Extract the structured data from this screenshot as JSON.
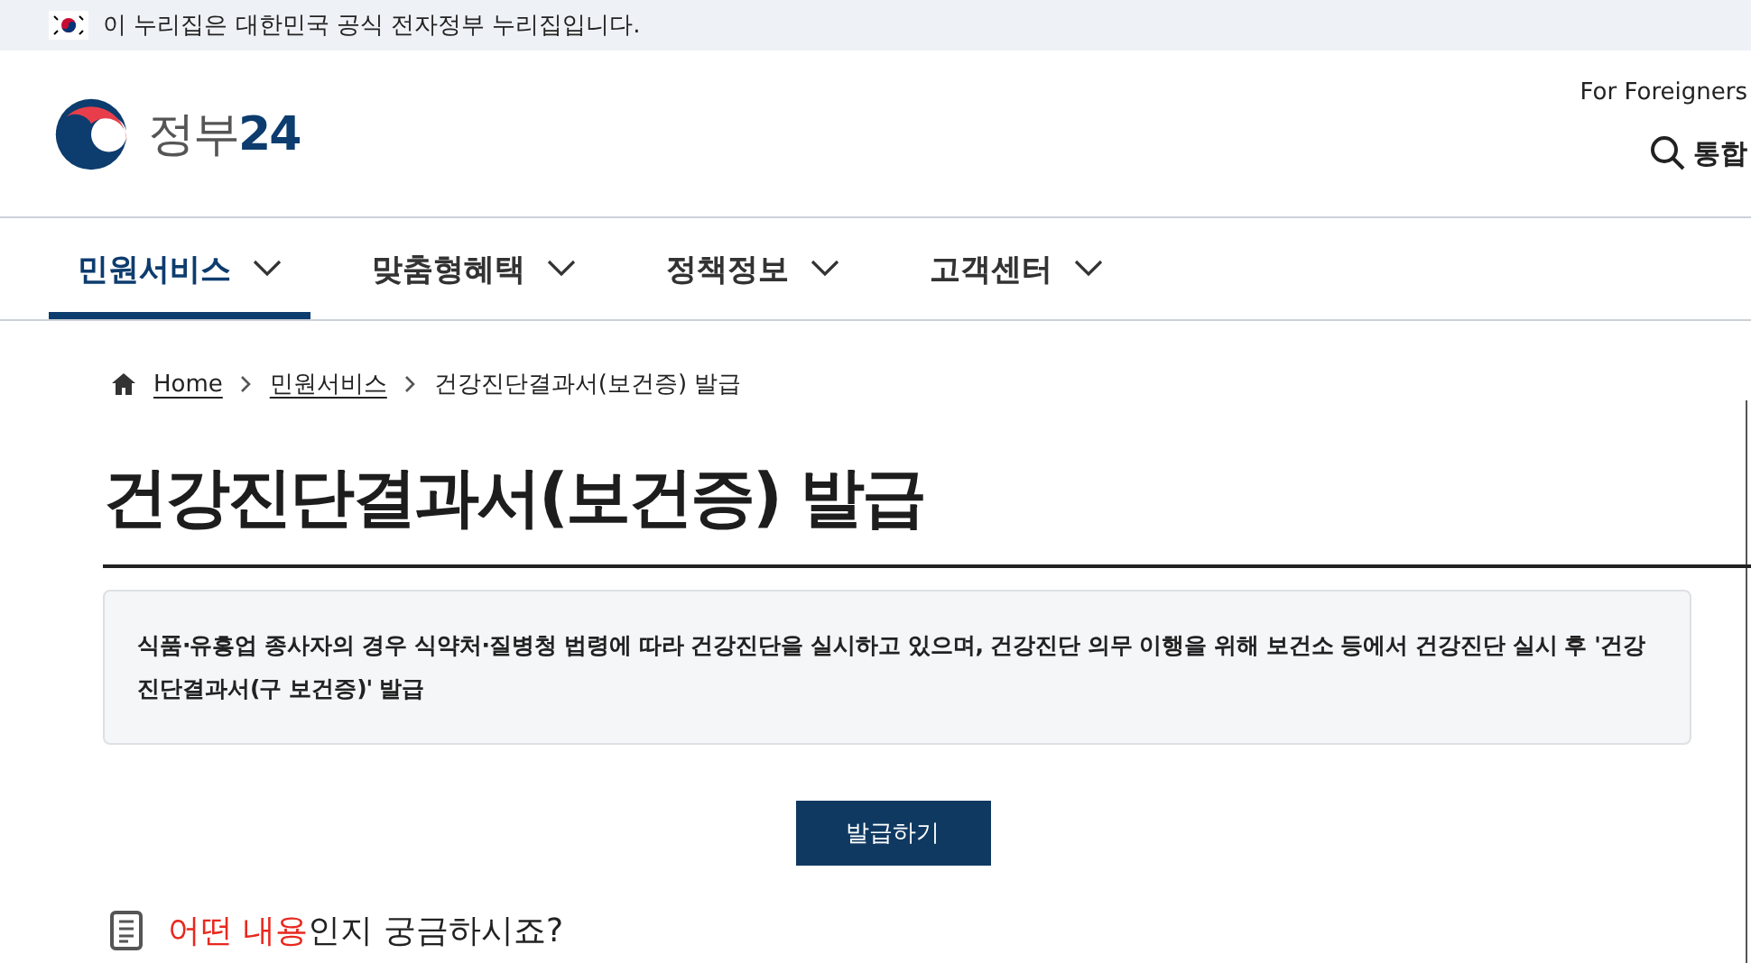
{
  "top_banner": {
    "text": "이 누리집은 대한민국 공식 전자정부 누리집입니다."
  },
  "header": {
    "logo_text": "정부",
    "logo_number": "24",
    "foreigners_link": "For Foreigners",
    "search_button": "통합"
  },
  "nav": [
    {
      "label": "민원서비스",
      "selected": true
    },
    {
      "label": "맞춤형혜택",
      "selected": false
    },
    {
      "label": "정책정보",
      "selected": false
    },
    {
      "label": "고객센터",
      "selected": false
    }
  ],
  "breadcrumb": [
    {
      "label": "Home",
      "kind": "home"
    },
    {
      "label": "민원서비스",
      "kind": "link"
    },
    {
      "label": "건강진단결과서(보건증) 발급",
      "kind": "current"
    }
  ],
  "title": "건강진단결과서(보건증) 발급",
  "info": "식품·유흥업 종사자의 경우 식약처·질병청 법령에 따라 건강진단을 실시하고 있으며, 건강진단 의무 이행을 위해 보건소 등에서 건강진단 실시 후 '건강진단결과서(구 보건증)' 발급",
  "issue_button": "발급하기",
  "question": {
    "highlight": "어떤 내용",
    "rest": "인지 궁금하시죠?"
  }
}
